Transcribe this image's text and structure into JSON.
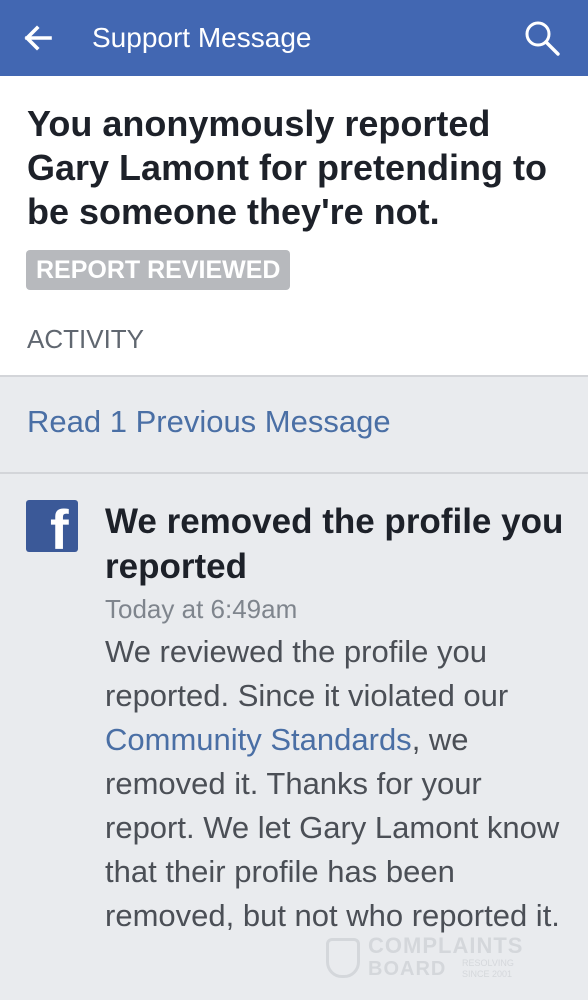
{
  "header": {
    "title": "Support Message",
    "back_icon": "arrow-left-icon",
    "search_icon": "search-icon",
    "bg_color": "#4267b2"
  },
  "summary": {
    "title": "You anonymously reported Gary Lamont for pretending to be someone they're not.",
    "status_badge": "REPORT REVIEWED",
    "activity_label": "ACTIVITY"
  },
  "previous_messages_link": "Read 1 Previous Message",
  "message": {
    "sender_icon": "facebook-logo-icon",
    "title": "We removed the profile you reported",
    "timestamp": "Today at 6:49am",
    "body_before_link": "We reviewed the profile you reported. Since it violated our ",
    "body_link": "Community Standards",
    "body_after_link": ", we removed it. Thanks for your report. We let Gary Lamont know that their profile has been removed, but not who reported it."
  },
  "watermark": {
    "line1": "COMPLAINTS",
    "line2": "BOARD",
    "tagline": "RESOLVING SINCE 2001"
  },
  "colors": {
    "link": "#4a6fa5",
    "badge_bg": "#b7b9bd",
    "page_bg": "#e9ebee"
  }
}
